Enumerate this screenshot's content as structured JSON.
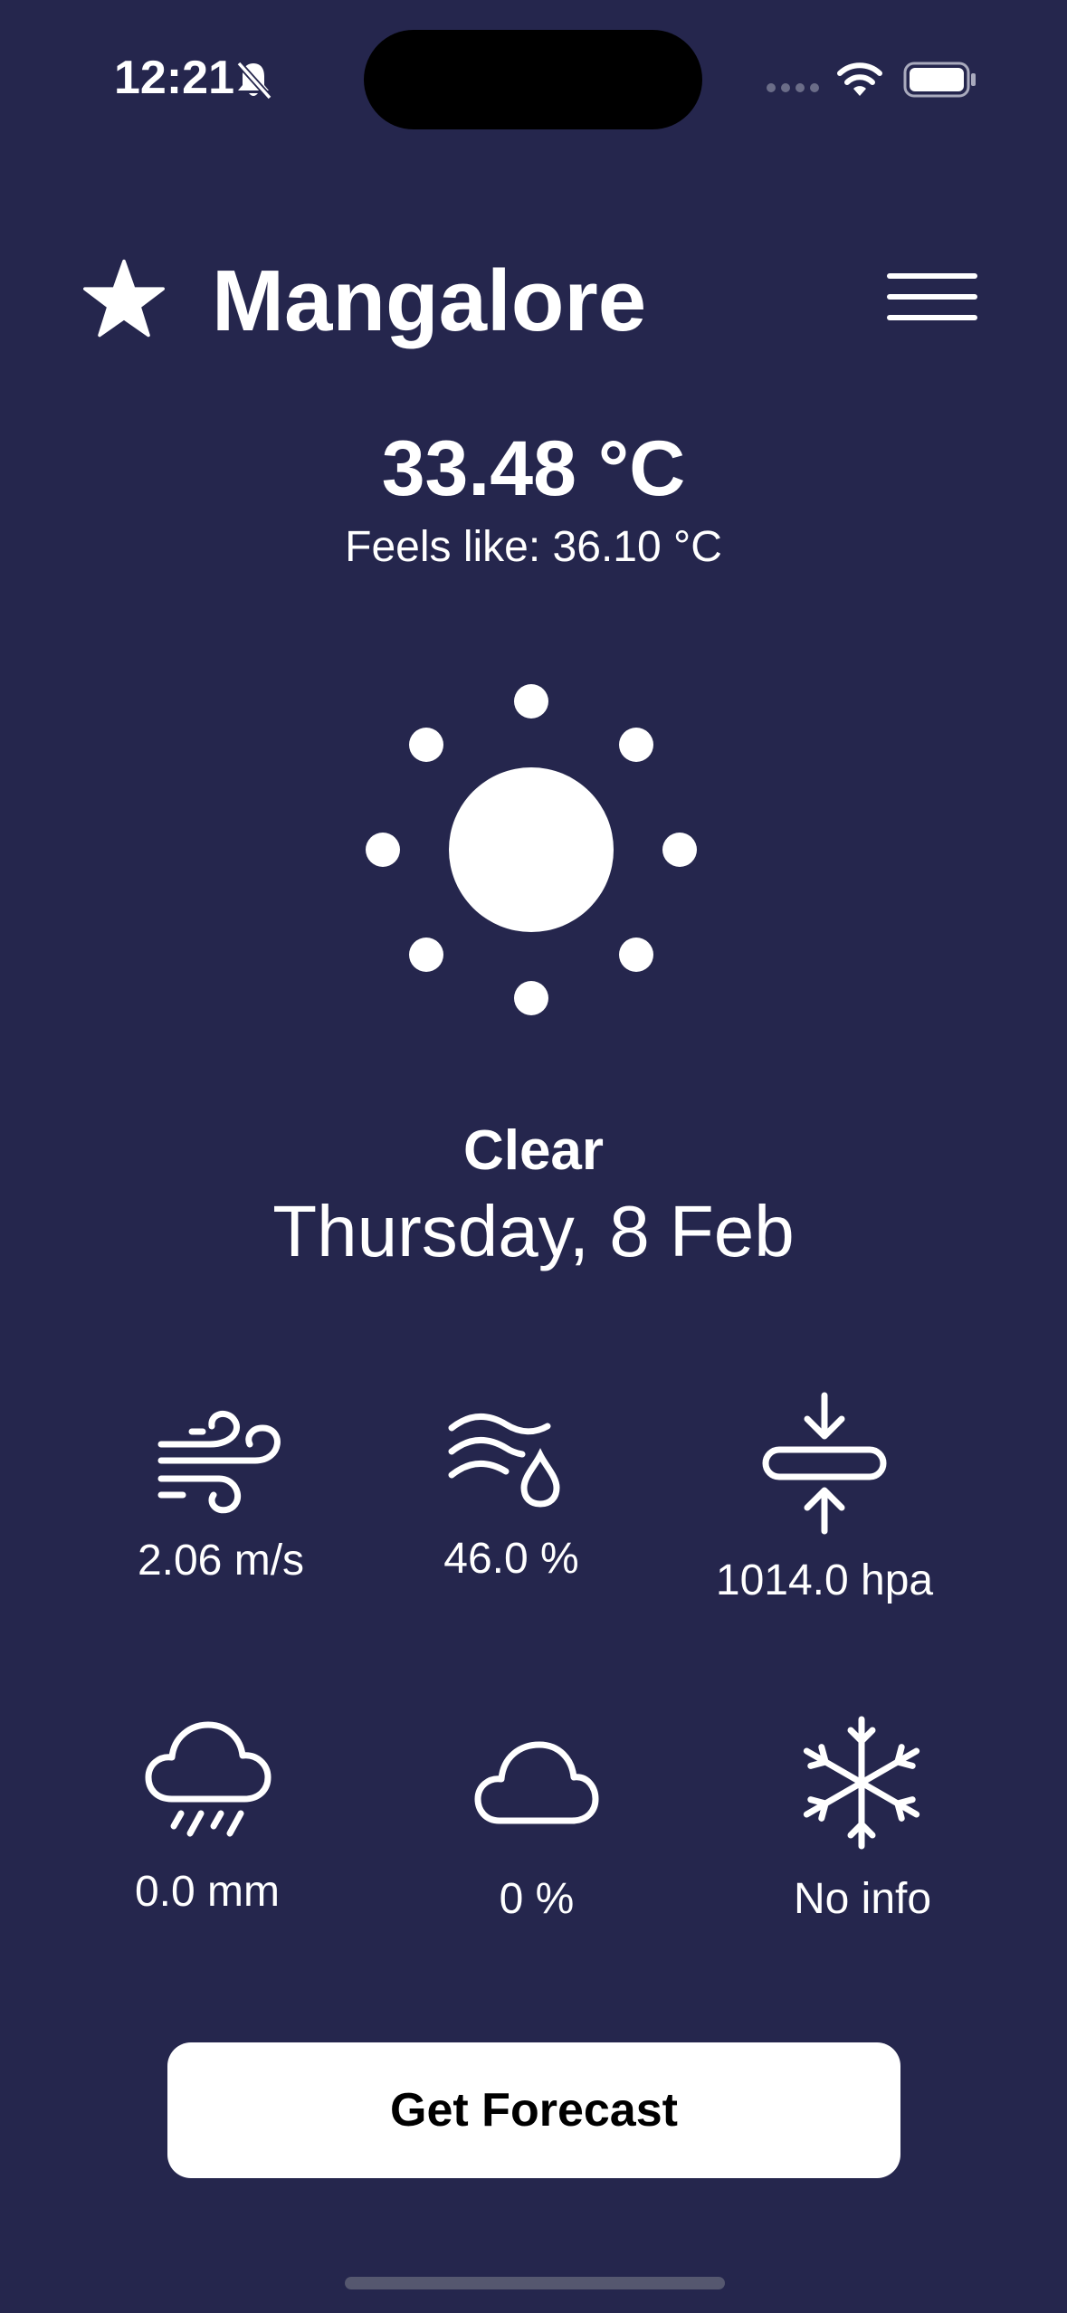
{
  "status_bar": {
    "time": "12:21",
    "icons": [
      "bell-slash-icon",
      "signal-icon",
      "wifi-icon",
      "battery-icon"
    ]
  },
  "header": {
    "city": "Mangalore",
    "favorite_icon": "star-icon",
    "menu_icon": "hamburger-menu-icon"
  },
  "weather": {
    "temperature": "33.48 °C",
    "feels_like": "Feels like: 36.10 °C",
    "icon": "sun-icon",
    "condition": "Clear",
    "date": "Thursday, 8 Feb"
  },
  "metrics": {
    "wind": {
      "icon": "wind-icon",
      "value": "2.06 m/s"
    },
    "humidity": {
      "icon": "humidity-icon",
      "value": "46.0 %"
    },
    "pressure": {
      "icon": "pressure-icon",
      "value": "1014.0 hpa"
    },
    "rain": {
      "icon": "rain-cloud-icon",
      "value": "0.0 mm"
    },
    "clouds": {
      "icon": "cloud-icon",
      "value": "0 %"
    },
    "snow": {
      "icon": "snowflake-icon",
      "value": "No info"
    }
  },
  "actions": {
    "forecast_label": "Get Forecast"
  },
  "colors": {
    "background": "#25264d",
    "foreground": "#ffffff",
    "button_background": "#ffffff",
    "button_text": "#000000"
  }
}
